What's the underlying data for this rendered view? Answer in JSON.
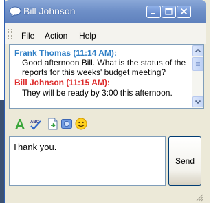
{
  "window": {
    "title": "Bill Johnson"
  },
  "menu": {
    "items": [
      "File",
      "Action",
      "Help"
    ]
  },
  "chat": {
    "entries": [
      {
        "sender": "Frank Thomas (11:14 AM):",
        "lines": [
          "Good afternoon Bill. What is the status of the",
          "reports for this weeks' budget meeting?"
        ],
        "color": "#2f7fc6"
      },
      {
        "sender": "Bill Johnson (11:15 AM):",
        "lines": [
          "They will be ready by 3:00 this afternoon."
        ],
        "color": "#dd2a2a"
      }
    ]
  },
  "toolbar": {
    "icons": [
      "font-icon",
      "spell-check-icon",
      "send-file-icon",
      "photo-icon",
      "emoticon-icon"
    ]
  },
  "compose": {
    "value": "Thank you."
  },
  "send_button": {
    "label": "Send"
  }
}
